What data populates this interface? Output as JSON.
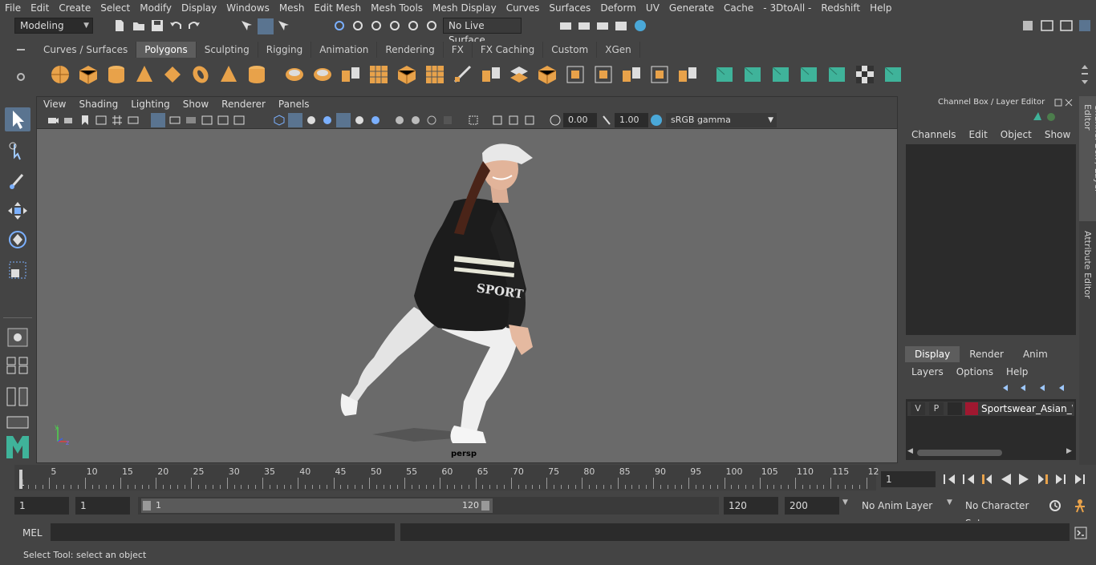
{
  "menubar": {
    "items": [
      "File",
      "Edit",
      "Create",
      "Select",
      "Modify",
      "Display",
      "Windows",
      "Mesh",
      "Edit Mesh",
      "Mesh Tools",
      "Mesh Display",
      "Curves",
      "Surfaces",
      "Deform",
      "UV",
      "Generate",
      "Cache",
      "- 3DtoAll -",
      "Redshift",
      "Help"
    ]
  },
  "statusline": {
    "mode": "Modeling",
    "live_surface": "No Live Surface"
  },
  "shelf": {
    "tabs": [
      "Curves / Surfaces",
      "Polygons",
      "Sculpting",
      "Rigging",
      "Animation",
      "Rendering",
      "FX",
      "FX Caching",
      "Custom",
      "XGen"
    ],
    "active_tab": "Polygons"
  },
  "viewport": {
    "menu": [
      "View",
      "Shading",
      "Lighting",
      "Show",
      "Renderer",
      "Panels"
    ],
    "exposure": "0.00",
    "gamma": "1.00",
    "color_space": "sRGB gamma",
    "camera_label": "persp"
  },
  "right_panel": {
    "title": "Channel Box / Layer Editor",
    "channel_menu": [
      "Channels",
      "Edit",
      "Object",
      "Show"
    ],
    "layer_tabs": [
      "Display",
      "Render",
      "Anim"
    ],
    "active_layer_tab": "Display",
    "layer_menu": [
      "Layers",
      "Options",
      "Help"
    ],
    "layer": {
      "v": "V",
      "p": "P",
      "name": "Sportswear_Asian_Wo",
      "color": "#a01830"
    },
    "side_tabs": [
      "Channel Box / Layer Editor",
      "Attribute Editor"
    ]
  },
  "timeline": {
    "ticks": [
      "5",
      "10",
      "15",
      "20",
      "25",
      "30",
      "35",
      "40",
      "45",
      "50",
      "55",
      "60",
      "65",
      "70",
      "75",
      "80",
      "85",
      "90",
      "95",
      "100",
      "105",
      "110",
      "115",
      "12"
    ],
    "start_label": "1",
    "current_frame": "1"
  },
  "range": {
    "start": "1",
    "playback_start": "1",
    "slider_start": "1",
    "slider_end": "120",
    "playback_end": "120",
    "end": "200",
    "anim_layer": "No Anim Layer",
    "character_set": "No Character Set"
  },
  "cmdline": {
    "label": "MEL"
  },
  "helpline": {
    "text": "Select Tool: select an object"
  },
  "colors": {
    "accent": "#5a7490",
    "shelf_orange": "#e8a24a",
    "shelf_green": "#3fb39a"
  }
}
